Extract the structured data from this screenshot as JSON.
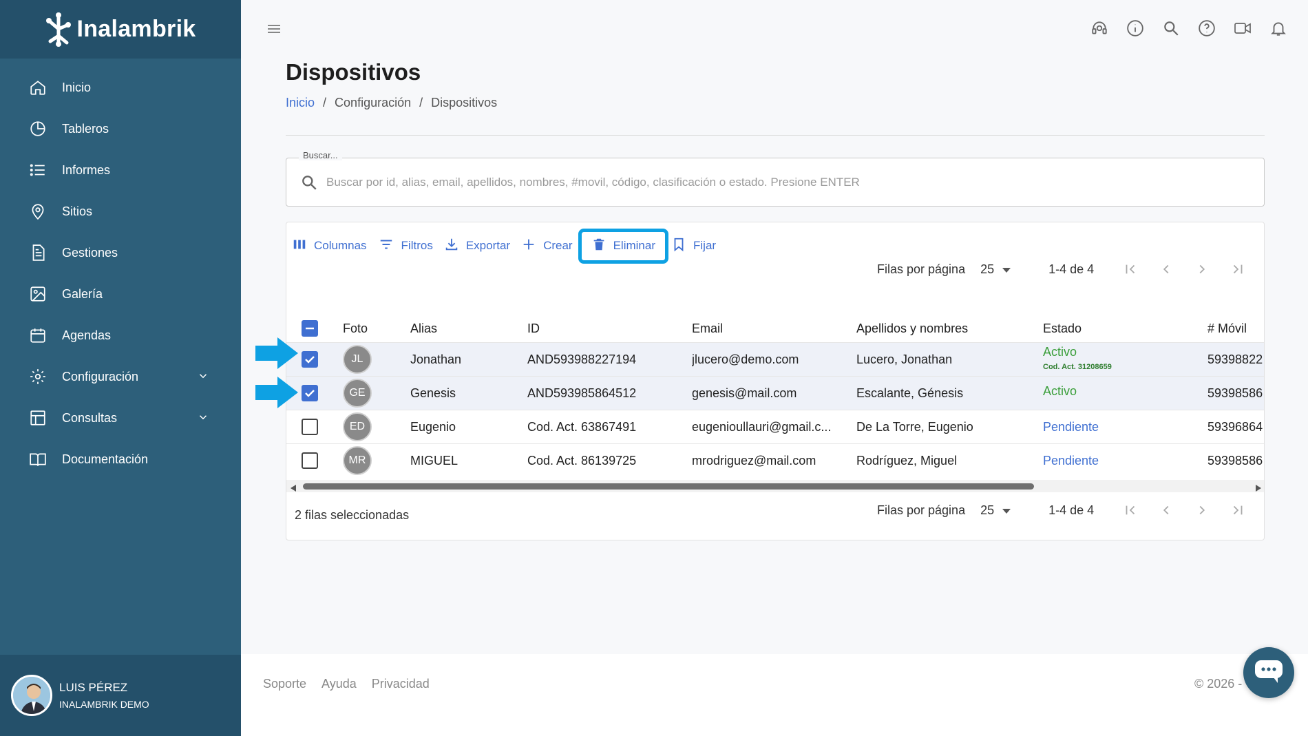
{
  "brand": {
    "name": "Inalambrik"
  },
  "sidebar": {
    "items": [
      {
        "label": "Inicio",
        "icon": "home-icon"
      },
      {
        "label": "Tableros",
        "icon": "pie-chart-icon"
      },
      {
        "label": "Informes",
        "icon": "list-icon"
      },
      {
        "label": "Sitios",
        "icon": "location-pin-icon"
      },
      {
        "label": "Gestiones",
        "icon": "document-icon"
      },
      {
        "label": "Galería",
        "icon": "image-icon"
      },
      {
        "label": "Agendas",
        "icon": "calendar-icon"
      },
      {
        "label": "Configuración",
        "icon": "gear-icon",
        "expandable": true
      },
      {
        "label": "Consultas",
        "icon": "table-icon",
        "expandable": true
      },
      {
        "label": "Documentación",
        "icon": "book-icon"
      }
    ]
  },
  "user": {
    "name": "LUIS PÉREZ",
    "org": "INALAMBRIK DEMO"
  },
  "topbar": {
    "icons": [
      "support-agent-icon",
      "info-icon",
      "search-icon",
      "help-icon",
      "video-icon",
      "bell-icon"
    ]
  },
  "page": {
    "title": "Dispositivos"
  },
  "breadcrumb": {
    "home": "Inicio",
    "sep": "/",
    "section": "Configuración",
    "current": "Dispositivos"
  },
  "search": {
    "legend": "Buscar...",
    "placeholder": "Buscar por id, alias, email, apellidos, nombres, #movil, código, clasificación o estado. Presione ENTER"
  },
  "toolbar": {
    "columns": "Columnas",
    "filters": "Filtros",
    "export": "Exportar",
    "create": "Crear",
    "delete": "Eliminar",
    "pin": "Fijar"
  },
  "pagination": {
    "rows_per_page_label": "Filas por página",
    "rows_per_page": "25",
    "range": "1-4 de 4"
  },
  "table": {
    "headers": {
      "photo": "Foto",
      "alias": "Alias",
      "id": "ID",
      "email": "Email",
      "name": "Apellidos y nombres",
      "status": "Estado",
      "mobile": "# Móvil"
    },
    "rows": [
      {
        "selected": true,
        "initials": "JL",
        "alias": "Jonathan",
        "id": "AND593988227194",
        "email": "jlucero@demo.com",
        "name": "Lucero, Jonathan",
        "status": "Activo",
        "status_sub": "Cod. Act. 31208659",
        "mobile": "59398822"
      },
      {
        "selected": true,
        "initials": "GE",
        "alias": "Genesis",
        "id": "AND593985864512",
        "email": "genesis@mail.com",
        "name": "Escalante, Génesis",
        "status": "Activo",
        "status_sub": "",
        "mobile": "59398586"
      },
      {
        "selected": false,
        "initials": "ED",
        "alias": "Eugenio",
        "id": "Cod. Act. 63867491",
        "email": "eugenioullauri@gmail.c...",
        "name": "De La Torre, Eugenio",
        "status": "Pendiente",
        "status_sub": "",
        "mobile": "59396864"
      },
      {
        "selected": false,
        "initials": "MR",
        "alias": "MIGUEL",
        "id": "Cod. Act. 86139725",
        "email": "mrodriguez@mail.com",
        "name": "Rodríguez, Miguel",
        "status": "Pendiente",
        "status_sub": "",
        "mobile": "59398586"
      }
    ],
    "selected_count": "2 filas seleccionadas"
  },
  "footer": {
    "links": [
      "Soporte",
      "Ayuda",
      "Privacidad"
    ],
    "copyright": "© 2026 -"
  },
  "colors": {
    "sidebar": "#2d5f7a",
    "sidebar_dark": "#24506a",
    "accent": "#3f6fd1",
    "highlight": "#0ea1e3",
    "active": "#3a9e3a"
  }
}
